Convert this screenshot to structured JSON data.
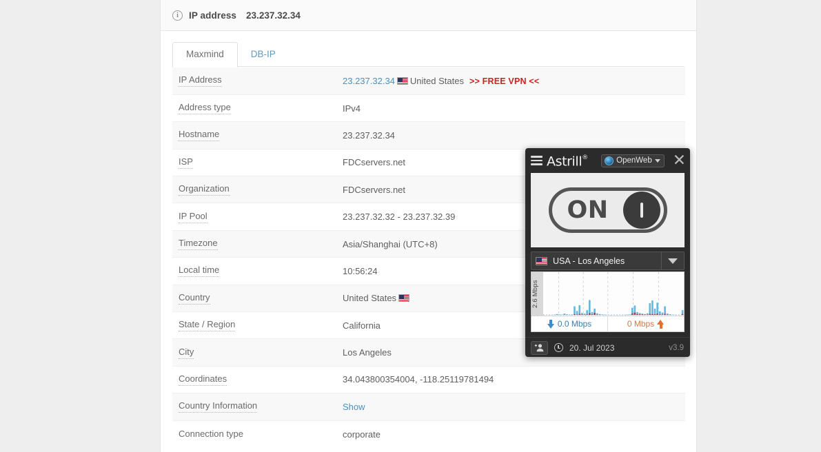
{
  "card": {
    "header": {
      "icon": "info-circle-icon",
      "label": "IP address",
      "ip": "23.237.32.34"
    },
    "tabs": [
      {
        "label": "Maxmind",
        "active": true
      },
      {
        "label": "DB-IP",
        "active": false
      }
    ],
    "rows": [
      {
        "label": "IP Address",
        "value": "",
        "type": "ip",
        "ip_link": "23.237.32.34",
        "country": "United States",
        "promo": ">> FREE VPN <<"
      },
      {
        "label": "Address type",
        "value": "IPv4",
        "type": "text"
      },
      {
        "label": "Hostname",
        "value": "23.237.32.34",
        "type": "text"
      },
      {
        "label": "ISP",
        "value": "FDCservers.net",
        "type": "text"
      },
      {
        "label": "Organization",
        "value": "FDCservers.net",
        "type": "text"
      },
      {
        "label": "IP Pool",
        "value": "23.237.32.32 - 23.237.32.39",
        "type": "text"
      },
      {
        "label": "Timezone",
        "value": "Asia/Shanghai (UTC+8)",
        "type": "text"
      },
      {
        "label": "Local time",
        "value": "10:56:24",
        "type": "text"
      },
      {
        "label": "Country",
        "value": "United States",
        "type": "country"
      },
      {
        "label": "State / Region",
        "value": "California",
        "type": "text"
      },
      {
        "label": "City",
        "value": "Los Angeles",
        "type": "text"
      },
      {
        "label": "Coordinates",
        "value": "34.043800354004, -118.25119781494",
        "type": "text"
      },
      {
        "label": "Country Information",
        "value": "Show",
        "type": "link"
      },
      {
        "label": "Connection type",
        "value": "corporate",
        "type": "text",
        "no_dotted": true
      }
    ]
  },
  "astrill": {
    "menu_icon": "hamburger-menu-icon",
    "brand": "Astrill",
    "brand_mark": "®",
    "protocol": {
      "icon": "globe-icon",
      "label": "OpenWeb",
      "caret": "chevron-down-icon"
    },
    "close": "✕",
    "toggle": {
      "label": "ON",
      "state": "on"
    },
    "server": {
      "flag": "us-flag-icon",
      "name": "USA - Los Angeles",
      "caret": "chevron-down-icon"
    },
    "graph": {
      "y_axis_label": "2.6 Mbps",
      "download_label": "0.0 Mbps",
      "upload_label": "0 Mbps",
      "download_icon": "download-arrow-icon",
      "upload_icon": "upload-arrow-icon"
    },
    "footer": {
      "user_icon": "add-user-icon",
      "clock_icon": "clock-icon",
      "date": "20. Jul 2023",
      "version": "v3.9"
    }
  },
  "chart_data": {
    "type": "area",
    "title": "Astrill connection throughput",
    "ylabel": "2.6 Mbps",
    "xlabel": "",
    "ylim": [
      0,
      2.6
    ],
    "grid": true,
    "legend": [
      "Download",
      "Upload"
    ],
    "series": [
      {
        "name": "Download",
        "color": "#63b8e0",
        "values": [
          0,
          0,
          0,
          0,
          0.02,
          0.05,
          0.03,
          0.02,
          0.08,
          0.04,
          0.02,
          0.03,
          0.55,
          0.25,
          0.62,
          0.12,
          0.08,
          0.3,
          0.95,
          0.18,
          0.4,
          0.1,
          0.05,
          0.03,
          0.02,
          0.01,
          0,
          0,
          0,
          0,
          0,
          0,
          0.01,
          0.02,
          0.03,
          0.45,
          0.6,
          0.18,
          0.12,
          0.08,
          0.05,
          0.1,
          0.75,
          0.92,
          0.4,
          0.78,
          0.22,
          0.15,
          0.55,
          0.08,
          0.04,
          0.02,
          0.01,
          0,
          0,
          0.3
        ]
      },
      {
        "name": "Upload",
        "color": "#9c3b3b",
        "values": [
          0,
          0,
          0,
          0,
          0,
          0.01,
          0,
          0,
          0.01,
          0,
          0,
          0,
          0.04,
          0.02,
          0.06,
          0.02,
          0.01,
          0.03,
          0.1,
          0.03,
          0.12,
          0.02,
          0.01,
          0,
          0,
          0,
          0,
          0,
          0,
          0,
          0,
          0,
          0,
          0,
          0,
          0.08,
          0.14,
          0.05,
          0.04,
          0.03,
          0.02,
          0.02,
          0.06,
          0.05,
          0.04,
          0.07,
          0.03,
          0.02,
          0.06,
          0.02,
          0.01,
          0,
          0,
          0,
          0,
          0.05
        ]
      }
    ],
    "current_download": "0.0 Mbps",
    "current_upload": "0 Mbps"
  }
}
